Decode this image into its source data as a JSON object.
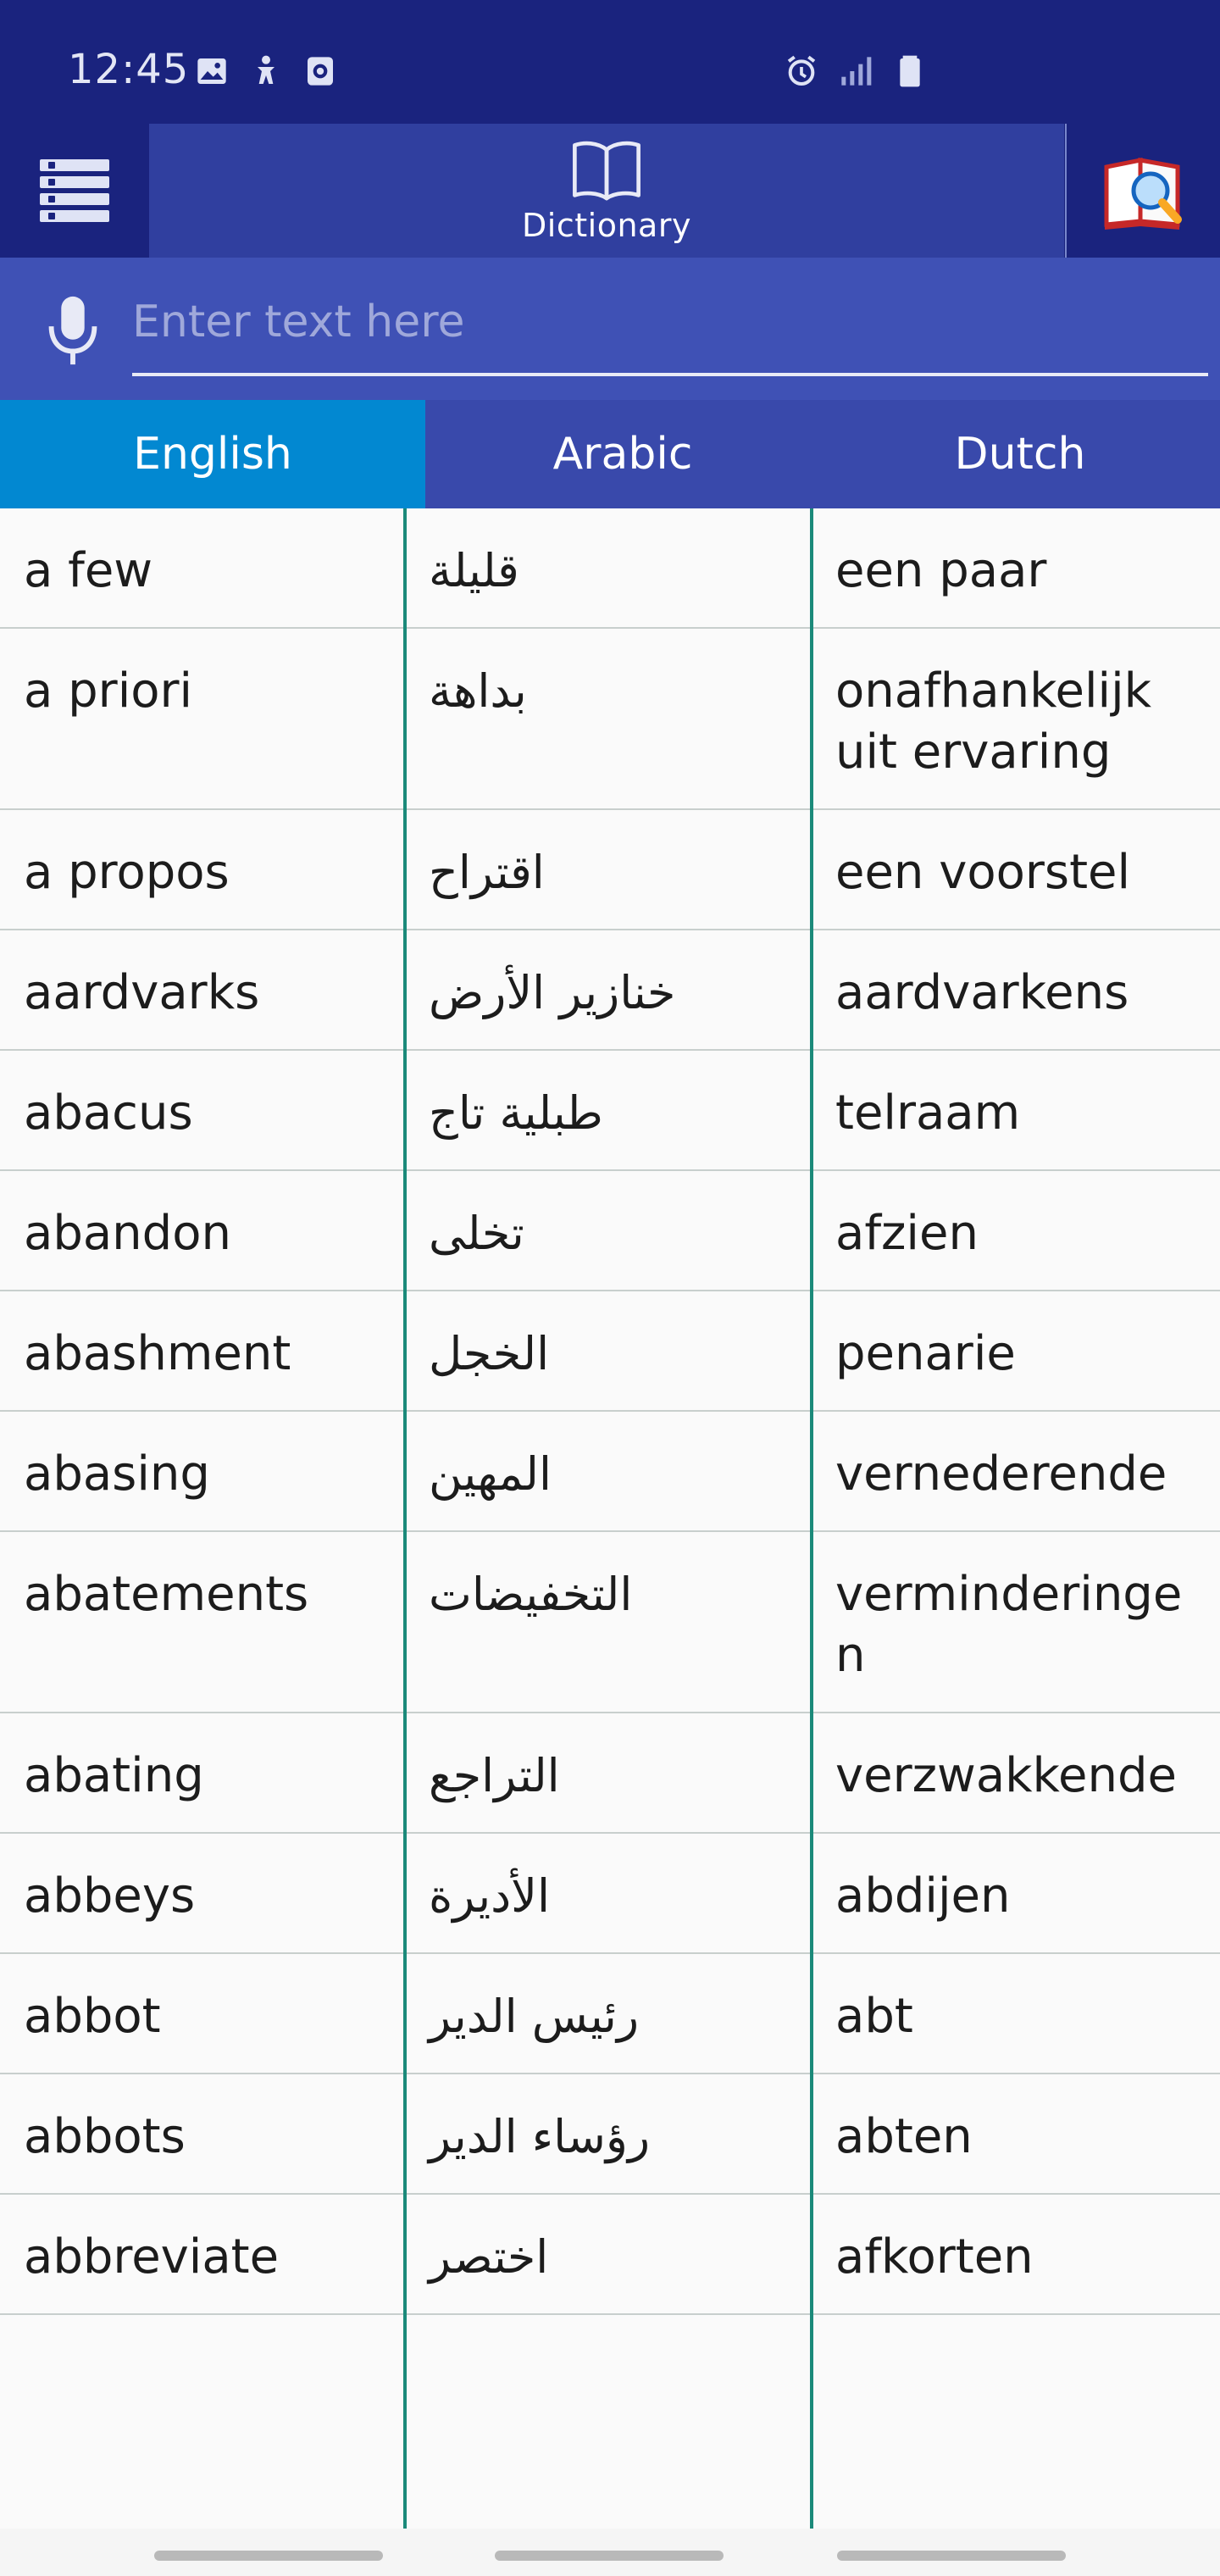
{
  "status_bar": {
    "time": "12:45",
    "left_icons": [
      "image-icon",
      "accessibility-icon",
      "screen-recorder-icon"
    ],
    "right_icons": [
      "alarm-icon",
      "signal-icon",
      "battery-icon"
    ]
  },
  "app_bar": {
    "menu_icon": "menu-icon",
    "tab_label": "Dictionary",
    "tab_icon": "book-icon",
    "right_icon": "book-search-icon"
  },
  "search": {
    "placeholder": "Enter text here",
    "value": "",
    "icon": "microphone-icon"
  },
  "languages": [
    "English",
    "Arabic",
    "Dutch"
  ],
  "active_language": "English",
  "rows": [
    {
      "en": "a few",
      "ar": "قليلة",
      "nl": "een paar"
    },
    {
      "en": "a priori",
      "ar": "بداهة",
      "nl": "onafhankelijk uit ervaring"
    },
    {
      "en": "a propos",
      "ar": "اقتراح",
      "nl": "een voorstel"
    },
    {
      "en": "aardvarks",
      "ar": "خنازير الأرض",
      "nl": "aardvarkens"
    },
    {
      "en": "abacus",
      "ar": "طبلية تاج",
      "nl": "telraam"
    },
    {
      "en": "abandon",
      "ar": "تخلى",
      "nl": "afzien"
    },
    {
      "en": "abashment",
      "ar": "الخجل",
      "nl": "penarie"
    },
    {
      "en": "abasing",
      "ar": "المهين",
      "nl": "vernederende"
    },
    {
      "en": "abatements",
      "ar": "التخفيضات",
      "nl": "verminderingen"
    },
    {
      "en": "abating",
      "ar": "التراجع",
      "nl": "verzwakkende"
    },
    {
      "en": "abbeys",
      "ar": "الأديرة",
      "nl": "abdijen"
    },
    {
      "en": "abbot",
      "ar": "رئيس الدير",
      "nl": "abt"
    },
    {
      "en": "abbots",
      "ar": "رؤساء الدير",
      "nl": "abten"
    },
    {
      "en": "abbreviate",
      "ar": "اختصر",
      "nl": "afkorten"
    }
  ],
  "colors": {
    "status_bar": "#1a237e",
    "app_bar_tab": "#303f9f",
    "search_bar": "#3f51b5",
    "lang_tabs": "#3949ab",
    "active_tab": "#0288d1",
    "column_divider": "#1b8a7a"
  }
}
